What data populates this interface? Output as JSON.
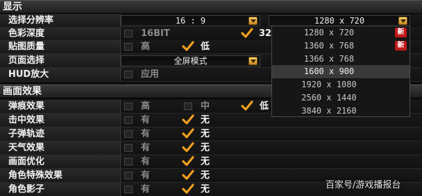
{
  "sections": {
    "display": "显示",
    "effects": "画面效果"
  },
  "display_rows": {
    "resolution": {
      "label": "选择分辨率",
      "aspect_value": "16 : 9",
      "resolution_value": "1280 x 720"
    },
    "color_depth": {
      "label": "色彩深度",
      "option_16": "16BIT",
      "option_32_partial": "32"
    },
    "texture_quality": {
      "label": "贴图质量",
      "option_high": "高",
      "option_low": "低"
    },
    "page_mode": {
      "label": "页面选择",
      "value": "全屏模式"
    },
    "hud_scale": {
      "label": "HUD放大",
      "option_apply": "应用"
    }
  },
  "resolution_popup": {
    "items": [
      {
        "label": "1280 x 720",
        "badge": "新"
      },
      {
        "label": "1360 x 768",
        "badge": "新"
      },
      {
        "label": "1366 x 768",
        "badge": ""
      },
      {
        "label": "1600 x 900",
        "badge": ""
      },
      {
        "label": "1920 x 1080",
        "badge": ""
      },
      {
        "label": "2560 x 1440",
        "badge": ""
      },
      {
        "label": "3840 x 2160",
        "badge": ""
      }
    ],
    "highlighted_index": 3
  },
  "effect_rows": {
    "bullet_marks": {
      "label": "弹痕效果",
      "high": "高",
      "mid": "中",
      "low": "低"
    },
    "hit_effect": {
      "label": "击中效果",
      "yes": "有",
      "no": "无"
    },
    "bullet_trail": {
      "label": "子弹轨迹",
      "yes": "有",
      "no": "无"
    },
    "weather": {
      "label": "天气效果",
      "yes": "有",
      "no": "无"
    },
    "screen_opt": {
      "label": "画面优化",
      "yes": "有",
      "no": "无"
    },
    "char_effects": {
      "label": "角色特殊效果",
      "yes": "有",
      "no": "无"
    },
    "char_shadow": {
      "label": "角色影子",
      "yes": "有",
      "no": "无"
    }
  },
  "watermark": "百家号/游戏播报台",
  "colors": {
    "checkmark": "#f0a020",
    "badge_red": "#c01818"
  }
}
